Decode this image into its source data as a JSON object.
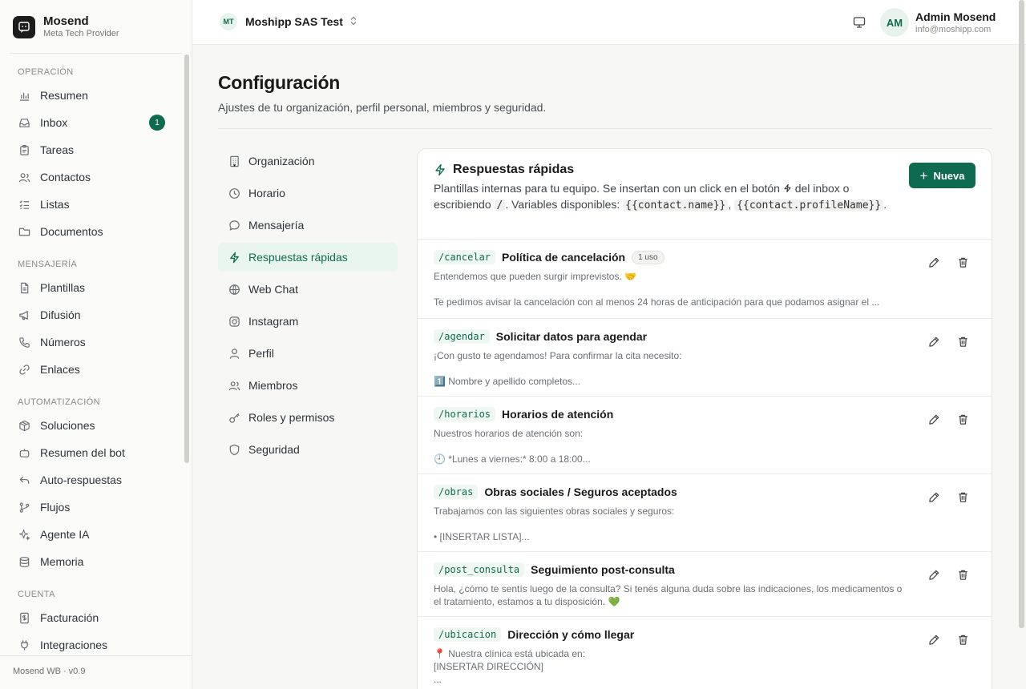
{
  "brand": {
    "name": "Mosend",
    "subtitle": "Meta Tech Provider"
  },
  "sidebar": {
    "sections": [
      {
        "heading": "OPERACIÓN",
        "items": [
          {
            "label": "Resumen",
            "icon": "bar-chart-icon"
          },
          {
            "label": "Inbox",
            "icon": "inbox-icon",
            "badge": "1"
          },
          {
            "label": "Tareas",
            "icon": "clipboard-icon"
          },
          {
            "label": "Contactos",
            "icon": "users-icon"
          },
          {
            "label": "Listas",
            "icon": "list-check-icon"
          },
          {
            "label": "Documentos",
            "icon": "folder-icon"
          }
        ]
      },
      {
        "heading": "MENSAJERÍA",
        "items": [
          {
            "label": "Plantillas",
            "icon": "file-icon"
          },
          {
            "label": "Difusión",
            "icon": "megaphone-icon"
          },
          {
            "label": "Números",
            "icon": "phone-icon"
          },
          {
            "label": "Enlaces",
            "icon": "link-icon"
          }
        ]
      },
      {
        "heading": "AUTOMATIZACIÓN",
        "items": [
          {
            "label": "Soluciones",
            "icon": "package-icon"
          },
          {
            "label": "Resumen del bot",
            "icon": "bot-icon"
          },
          {
            "label": "Auto-respuestas",
            "icon": "reply-icon"
          },
          {
            "label": "Flujos",
            "icon": "git-branch-icon"
          },
          {
            "label": "Agente IA",
            "icon": "sparkles-icon"
          },
          {
            "label": "Memoria",
            "icon": "database-icon"
          }
        ]
      },
      {
        "heading": "CUENTA",
        "items": [
          {
            "label": "Facturación",
            "icon": "receipt-icon"
          },
          {
            "label": "Integraciones",
            "icon": "plug-icon"
          }
        ]
      }
    ],
    "footer": "Mosend WB · v0.9"
  },
  "topbar": {
    "org_initials": "MT",
    "org_name": "Moshipp SAS Test",
    "user_initials": "AM",
    "user_name": "Admin Mosend",
    "user_email": "info@moshipp.com"
  },
  "page": {
    "title": "Configuración",
    "subtitle": "Ajustes de tu organización, perfil personal, miembros y seguridad."
  },
  "settings_nav": [
    {
      "label": "Organización",
      "icon": "building-icon"
    },
    {
      "label": "Horario",
      "icon": "clock-icon"
    },
    {
      "label": "Mensajería",
      "icon": "message-icon"
    },
    {
      "label": "Respuestas rápidas",
      "icon": "zap-icon",
      "active": true
    },
    {
      "label": "Web Chat",
      "icon": "globe-icon"
    },
    {
      "label": "Instagram",
      "icon": "instagram-icon"
    },
    {
      "label": "Perfil",
      "icon": "user-icon"
    },
    {
      "label": "Miembros",
      "icon": "users-icon"
    },
    {
      "label": "Roles y permisos",
      "icon": "key-icon"
    },
    {
      "label": "Seguridad",
      "icon": "shield-icon"
    }
  ],
  "quick_replies": {
    "title": "Respuestas rápidas",
    "desc_part1": "Plantillas internas para tu equipo. Se insertan con un click en el botón",
    "desc_part2": "del inbox o escribiendo",
    "desc_slash": "/",
    "desc_part3": ". Variables disponibles:",
    "var1": "{{contact.name}}",
    "desc_comma": ",",
    "var2": "{{contact.profileName}}",
    "desc_end": ".",
    "new_button": "Nueva",
    "items": [
      {
        "shortcut": "/cancelar",
        "title": "Política de cancelación",
        "uses": "1 uso",
        "line1": "Entendemos que pueden surgir imprevistos. 🤝",
        "line2": "Te pedimos avisar la cancelación con al menos 24 horas de anticipación para que podamos asignar el ..."
      },
      {
        "shortcut": "/agendar",
        "title": "Solicitar datos para agendar",
        "line1": "¡Con gusto te agendamos! Para confirmar la cita necesito:",
        "line2": "1️⃣ Nombre y apellido completos..."
      },
      {
        "shortcut": "/horarios",
        "title": "Horarios de atención",
        "line1": "Nuestros horarios de atención son:",
        "line2": "🕘 *Lunes a viernes:* 8:00 a 18:00..."
      },
      {
        "shortcut": "/obras",
        "title": "Obras sociales / Seguros aceptados",
        "line1": "Trabajamos con las siguientes obras sociales y seguros:",
        "line2": "• [INSERTAR LISTA]..."
      },
      {
        "shortcut": "/post_consulta",
        "title": "Seguimiento post-consulta",
        "line1": "Hola, ¿cómo te sentís luego de la consulta? Si tenés alguna duda sobre las indicaciones, los medicamentos o",
        "line2": "el tratamiento, estamos a tu disposición. 💚"
      },
      {
        "shortcut": "/ubicacion",
        "title": "Dirección y cómo llegar",
        "line1": "📍 Nuestra clínica está ubicada en:",
        "line2": "[INSERTAR DIRECCIÓN]",
        "line3": "..."
      }
    ]
  }
}
